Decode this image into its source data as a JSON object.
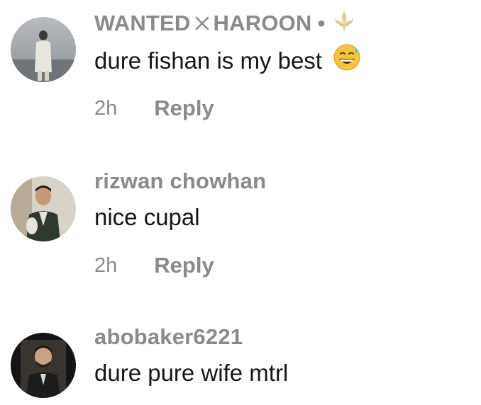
{
  "comments": [
    {
      "username_part1": "WANTED",
      "username_part2": "HAROON",
      "separator": "•",
      "badge_icon": "fleur-de-lis-icon",
      "text": "dure fishan is my best",
      "emoji": "grinning-face-with-sweat-icon",
      "time": "2h",
      "reply_label": "Reply"
    },
    {
      "username": "rizwan chowhan",
      "text": "nice cupal",
      "time": "2h",
      "reply_label": "Reply"
    },
    {
      "username": "abobaker6221",
      "text": "dure pure wife mtrl"
    }
  ],
  "colors": {
    "username": "#8a8a8a",
    "text": "#161616",
    "meta": "#8a8a8a",
    "badge": "#e3c98a"
  }
}
